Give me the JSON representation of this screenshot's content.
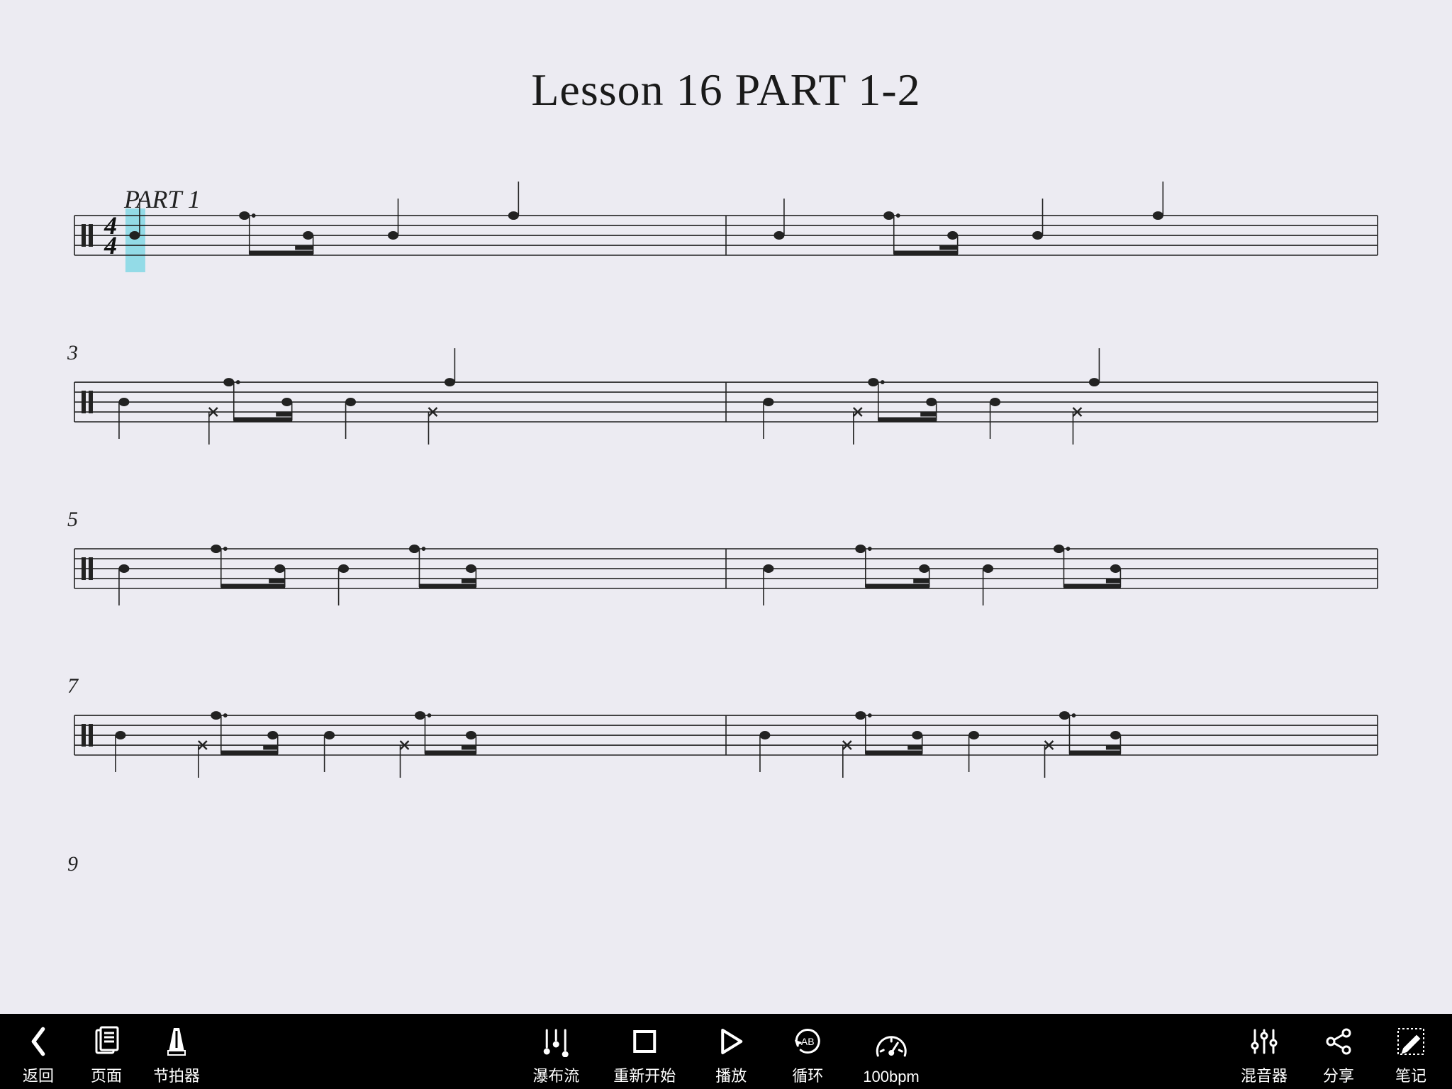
{
  "title": "Lesson 16 PART 1-2",
  "part_label": "PART 1",
  "time_signature": "4/4",
  "bar_numbers": [
    "",
    "3",
    "5",
    "7",
    "9"
  ],
  "toolbar": {
    "back": "返回",
    "pages": "页面",
    "metronome": "节拍器",
    "waterfall": "瀑布流",
    "restart": "重新开始",
    "play": "播放",
    "loop": "循环",
    "tempo": "100bpm",
    "mixer": "混音器",
    "share": "分享",
    "notes": "笔记"
  }
}
